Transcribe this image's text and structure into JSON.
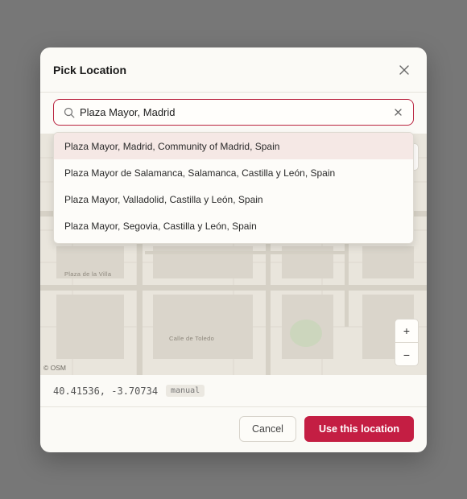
{
  "dialog": {
    "title": "Pick Location",
    "close_icon": "close-icon"
  },
  "search": {
    "value": "Plaza Mayor, Madrid",
    "placeholder": "",
    "icon": "search-icon",
    "clear_icon": "clear-icon"
  },
  "suggestions": [
    {
      "label": "Plaza Mayor, Madrid, Community of Madrid, Spain",
      "active": true
    },
    {
      "label": "Plaza Mayor de Salamanca, Salamanca, Castilla y León, Spain",
      "active": false
    },
    {
      "label": "Plaza Mayor, Valladolid, Castilla y León, Spain",
      "active": false
    },
    {
      "label": "Plaza Mayor, Segovia, Castilla y León, Spain",
      "active": false
    }
  ],
  "map": {
    "labels": [
      "Plaza de la Villa",
      "Calle de Toledo"
    ],
    "attribution": "© OSM",
    "zoom_in": "+",
    "zoom_out": "−"
  },
  "location": {
    "coordinates": "40.41536, -3.70734",
    "mode": "manual"
  },
  "footer": {
    "cancel_label": "Cancel",
    "confirm_label": "Use this location"
  },
  "colors": {
    "accent": "#c41e43",
    "active_suggestion_bg": "#f5e8e5",
    "backdrop": "#777777"
  }
}
